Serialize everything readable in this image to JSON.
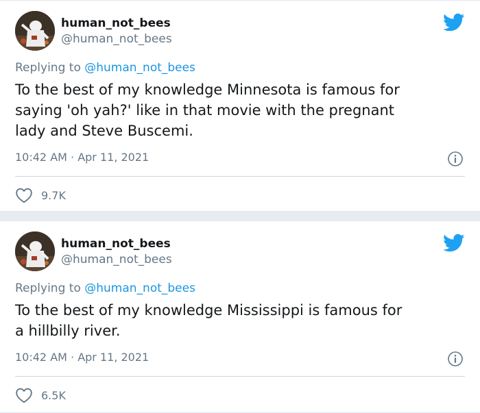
{
  "tweets": [
    {
      "display_name": "human_not_bees",
      "handle": "@human_not_bees",
      "replying_prefix": "Replying to ",
      "replying_to": "@human_not_bees",
      "text": "To the best of my knowledge Minnesota is famous for\nsaying 'oh yah?' like in that movie with the pregnant\nlady and Steve Buscemi.",
      "time": "10:42 AM · Apr 11, 2021",
      "likes": "9.7K"
    },
    {
      "display_name": "human_not_bees",
      "handle": "@human_not_bees",
      "replying_prefix": "Replying to ",
      "replying_to": "@human_not_bees",
      "text": "To the best of my knowledge Mississippi is famous for\na hillbilly river.",
      "time": "10:42 AM · Apr 11, 2021",
      "likes": "6.5K"
    }
  ],
  "colors": {
    "brand": "#1da1f2",
    "mention": "#1b95e0",
    "primary_text": "#14171a",
    "secondary_text": "#657786"
  },
  "icons": {
    "logo": "twitter-bird-icon",
    "info": "info-circle-icon",
    "like": "heart-outline-icon"
  }
}
